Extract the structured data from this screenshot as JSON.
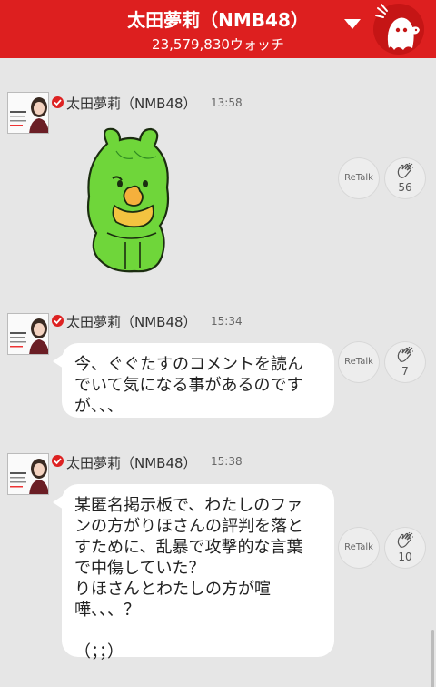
{
  "header": {
    "title": "太田夢莉（NMB48）",
    "watch_count": "23,579,830ウォッチ",
    "bg_color": "#dd1f1f"
  },
  "posts": [
    {
      "author": "太田夢莉（NMB48）",
      "time": "13:58",
      "type": "sticker",
      "sticker": "green-bear-sticker",
      "retalk_label": "ReTalk",
      "clap_count": "56"
    },
    {
      "author": "太田夢莉（NMB48）",
      "time": "15:34",
      "type": "text",
      "text": "今、ぐぐたすのコメントを読ん\nでいて気になる事があるのです\nが、、、",
      "retalk_label": "ReTalk",
      "clap_count": "7"
    },
    {
      "author": "太田夢莉（NMB48）",
      "time": "15:38",
      "type": "text",
      "text": "某匿名掲示板で、わたしのファ\nンの方がりほさんの評判を落と\nすために、乱暴で攻撃的な言葉\nで中傷していた？\nりほさんとわたしの方が喧\n嘩、、、？\n\n（；；）",
      "retalk_label": "ReTalk",
      "clap_count": "10"
    }
  ],
  "icons": {
    "dropdown": "chevron-down-icon",
    "mascot": "ghost-mascot-icon",
    "verified": "verified-check-icon",
    "clap": "clap-hands-icon"
  }
}
